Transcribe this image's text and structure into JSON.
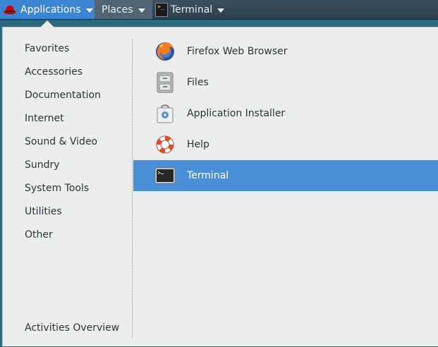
{
  "topbar": {
    "applications_label": "Applications",
    "places_label": "Places",
    "terminal_label": "Terminal"
  },
  "menu": {
    "categories": [
      {
        "label": "Favorites"
      },
      {
        "label": "Accessories"
      },
      {
        "label": "Documentation"
      },
      {
        "label": "Internet"
      },
      {
        "label": "Sound & Video"
      },
      {
        "label": "Sundry"
      },
      {
        "label": "System Tools"
      },
      {
        "label": "Utilities"
      },
      {
        "label": "Other"
      }
    ],
    "activities_overview": "Activities Overview",
    "apps": [
      {
        "label": "Firefox Web Browser",
        "icon": "firefox-icon",
        "selected": false
      },
      {
        "label": "Files",
        "icon": "files-icon",
        "selected": false
      },
      {
        "label": "Application Installer",
        "icon": "app-installer-icon",
        "selected": false
      },
      {
        "label": "Help",
        "icon": "help-lifebuoy-icon",
        "selected": false
      },
      {
        "label": "Terminal",
        "icon": "terminal-icon",
        "selected": true
      }
    ]
  },
  "colors": {
    "accent": "#4a90d9",
    "topbar_active": "#3b86d3",
    "menu_bg": "#eceded",
    "desktop": "#2a6a7c"
  }
}
